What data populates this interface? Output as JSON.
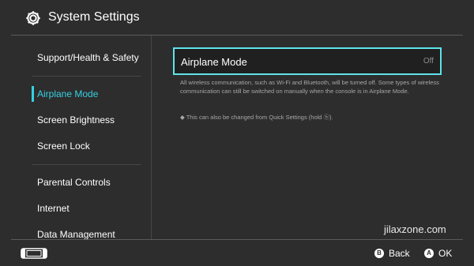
{
  "header": {
    "title": "System Settings",
    "icon": "gear-icon"
  },
  "sidebar": {
    "items": [
      {
        "label": "Support/Health & Safety",
        "selected": false
      },
      {
        "label": "Airplane Mode",
        "selected": true
      },
      {
        "label": "Screen Brightness",
        "selected": false
      },
      {
        "label": "Screen Lock",
        "selected": false
      },
      {
        "label": "Parental Controls",
        "selected": false
      },
      {
        "label": "Internet",
        "selected": false
      },
      {
        "label": "Data Management",
        "selected": false
      }
    ]
  },
  "main": {
    "setting": {
      "name": "Airplane Mode",
      "value": "Off"
    },
    "description": "All wireless communication, such as Wi-Fi and Bluetooth, will be turned off. Some types of wireless communication can still be switched on manually when the console is in Airplane Mode.",
    "note": "◆ This can also be changed from Quick Settings (hold ⓗ)."
  },
  "watermark": "jilaxzone.com",
  "footer": {
    "console_icon": "console-icon",
    "back": {
      "button": "B",
      "label": "Back"
    },
    "ok": {
      "button": "A",
      "label": "OK"
    }
  },
  "colors": {
    "accent": "#36d0e3",
    "background": "#2d2d2d",
    "highlight_border": "#5fe3ea"
  }
}
